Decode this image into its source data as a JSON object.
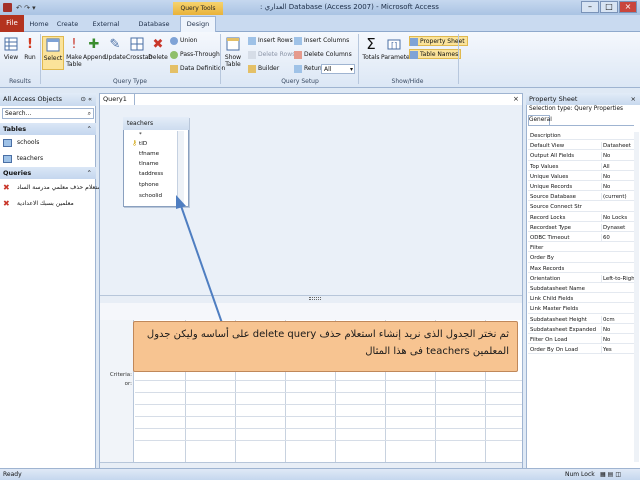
{
  "window": {
    "title": ": العداري Database (Access 2007) - Microsoft Access",
    "context_label": "Query Tools"
  },
  "tabs": {
    "file": "File",
    "home": "Home",
    "create": "Create",
    "external": "External Data",
    "dbtools": "Database Tools",
    "design": "Design"
  },
  "ribbon": {
    "results": {
      "label": "Results",
      "view": "View",
      "run": "Run"
    },
    "query_type": {
      "label": "Query Type",
      "select": "Select",
      "make_table": "Make Table",
      "append": "Append",
      "update": "Update",
      "crosstab": "Crosstab",
      "delete": "Delete",
      "union": "Union",
      "pass_through": "Pass-Through",
      "data_definition": "Data Definition"
    },
    "query_setup": {
      "label": "Query Setup",
      "show_table": "Show Table",
      "insert_rows": "Insert Rows",
      "delete_rows": "Delete Rows",
      "builder": "Builder",
      "insert_columns": "Insert Columns",
      "delete_columns": "Delete Columns",
      "return_label": "Return:",
      "return_value": "All"
    },
    "show_hide": {
      "label": "Show/Hide",
      "totals": "Totals",
      "parameters": "Parameters",
      "property_sheet": "Property Sheet",
      "table_names": "Table Names"
    }
  },
  "nav": {
    "header": "All Access Objects",
    "search_placeholder": "Search...",
    "tables_header": "Tables",
    "tables": [
      "schools",
      "teachers"
    ],
    "queries_header": "Queries",
    "queries": [
      "استعلام حذف معلمي مدرسة الساد",
      "معلمين بسبك الاعدادية"
    ]
  },
  "query": {
    "tab": "Query1",
    "table_name": "teachers",
    "fields": [
      "*",
      "tID",
      "tfname",
      "tlname",
      "taddress",
      "tphone",
      "schoolid"
    ],
    "row_labels": [
      "Criteria:",
      "or:"
    ]
  },
  "callout": {
    "text": "ثم نختر الجدول الذى نريد إنشاء استعلام حذف delete query على أساسه وليكن جدول المعلمين teachers فى هذا المثال"
  },
  "property_sheet": {
    "title": "Property Sheet",
    "selection_type": "Selection type:  Query Properties",
    "tab": "General",
    "rows": [
      [
        "Description",
        ""
      ],
      [
        "Default View",
        "Datasheet"
      ],
      [
        "Output All Fields",
        "No"
      ],
      [
        "Top Values",
        "All"
      ],
      [
        "Unique Values",
        "No"
      ],
      [
        "Unique Records",
        "No"
      ],
      [
        "Source Database",
        "(current)"
      ],
      [
        "Source Connect Str",
        ""
      ],
      [
        "Record Locks",
        "No Locks"
      ],
      [
        "Recordset Type",
        "Dynaset"
      ],
      [
        "ODBC Timeout",
        "60"
      ],
      [
        "Filter",
        ""
      ],
      [
        "Order By",
        ""
      ],
      [
        "Max Records",
        ""
      ],
      [
        "Orientation",
        "Left-to-Right"
      ],
      [
        "Subdatasheet Name",
        ""
      ],
      [
        "Link Child Fields",
        ""
      ],
      [
        "Link Master Fields",
        ""
      ],
      [
        "Subdatasheet Height",
        "0cm"
      ],
      [
        "Subdatasheet Expanded",
        "No"
      ],
      [
        "Filter On Load",
        "No"
      ],
      [
        "Order By On Load",
        "Yes"
      ]
    ]
  },
  "status": {
    "left": "Ready",
    "num_lock": "Num Lock"
  }
}
